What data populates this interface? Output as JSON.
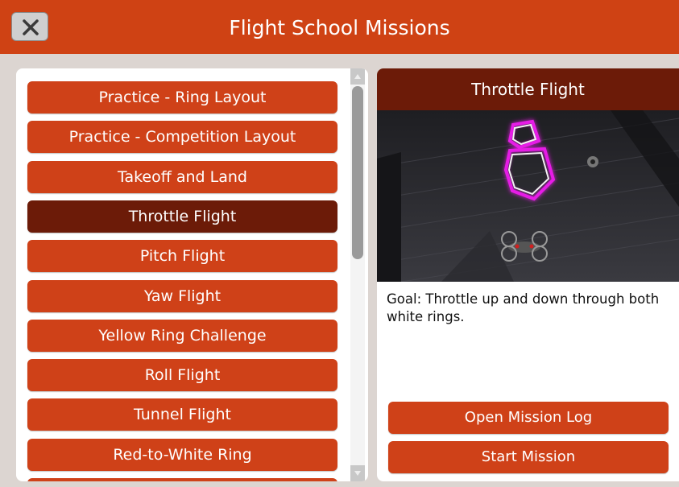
{
  "header": {
    "title": "Flight School Missions",
    "close_icon": "close-icon"
  },
  "missions": [
    {
      "label": "Practice - Ring Layout",
      "selected": false
    },
    {
      "label": "Practice - Competition Layout",
      "selected": false
    },
    {
      "label": "Takeoff and Land",
      "selected": false
    },
    {
      "label": "Throttle Flight",
      "selected": true
    },
    {
      "label": "Pitch Flight",
      "selected": false
    },
    {
      "label": "Yaw Flight",
      "selected": false
    },
    {
      "label": "Yellow Ring Challenge",
      "selected": false
    },
    {
      "label": "Roll Flight",
      "selected": false
    },
    {
      "label": "Tunnel Flight",
      "selected": false
    },
    {
      "label": "Red-to-White Ring",
      "selected": false
    }
  ],
  "detail": {
    "title": "Throttle Flight",
    "goal": "Goal: Throttle up and down through both white rings.",
    "open_log_label": "Open Mission Log",
    "start_label": "Start Mission"
  },
  "colors": {
    "accent": "#cf4214",
    "selected": "#6c1b08",
    "ring_glow": "#e61ee6"
  }
}
